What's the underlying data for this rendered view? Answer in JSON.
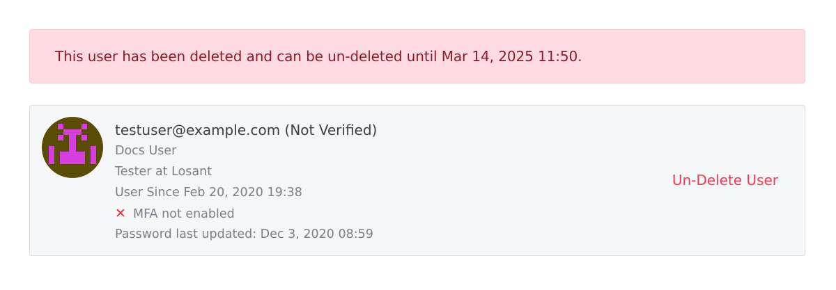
{
  "alert": {
    "message": "This user has been deleted and can be un-deleted until Mar 14, 2025 11:50."
  },
  "user": {
    "email_line": "testuser@example.com (Not Verified)",
    "name": "Docs User",
    "title": "Tester at Losant",
    "since": "User Since Feb 20, 2020 19:38",
    "mfa_status": "MFA not enabled",
    "mfa_icon": "x-icon",
    "password_updated": "Password last updated: Dec 3, 2020 08:59",
    "avatar_colors": {
      "background": "#5a4b05",
      "foreground": "#d63ee0"
    }
  },
  "actions": {
    "undelete_label": "Un-Delete User"
  },
  "colors": {
    "alert_bg": "#fedbe0",
    "alert_text": "#8b1a2b",
    "danger": "#f03a52"
  }
}
